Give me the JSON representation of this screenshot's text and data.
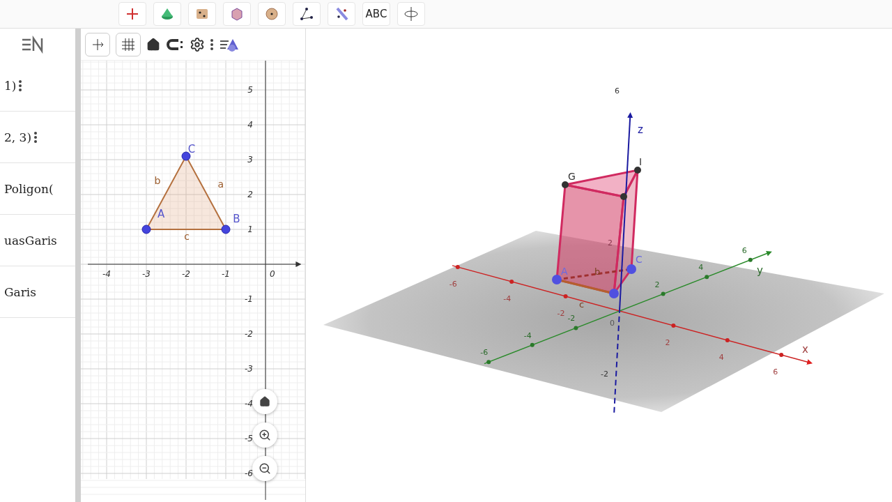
{
  "toolbar": {
    "text_tool": "ABC"
  },
  "algebra_view": {
    "rows": [
      {
        "text": "1)",
        "menu": true
      },
      {
        "text": "2, 3)",
        "menu": true
      },
      {
        "text": "Poligon(",
        "menu": false
      },
      {
        "text": "uasGaris",
        "menu": false
      },
      {
        "text": "Garis",
        "menu": false
      }
    ]
  },
  "graphics_2d": {
    "x_ticks": [
      "-4",
      "-3",
      "-2",
      "-1",
      "0"
    ],
    "y_ticks": [
      "5",
      "4",
      "3",
      "2",
      "1",
      "-1",
      "-2",
      "-3",
      "-4",
      "-5",
      "-6"
    ],
    "points": [
      "A",
      "B",
      "C"
    ],
    "sides": [
      "b",
      "a",
      "c"
    ]
  },
  "graphics_3d": {
    "axes": [
      "x",
      "y",
      "z"
    ],
    "x_ticks": [
      "-6",
      "-4",
      "-2",
      "2",
      "4",
      "6"
    ],
    "y_ticks": [
      "-6",
      "-4",
      "-2",
      "2",
      "4",
      "6"
    ],
    "z_ticks": [
      "6",
      "2",
      "-2"
    ],
    "origin": "0",
    "points": [
      "A",
      "C",
      "G",
      "I"
    ],
    "edges": [
      "b",
      "c"
    ]
  }
}
